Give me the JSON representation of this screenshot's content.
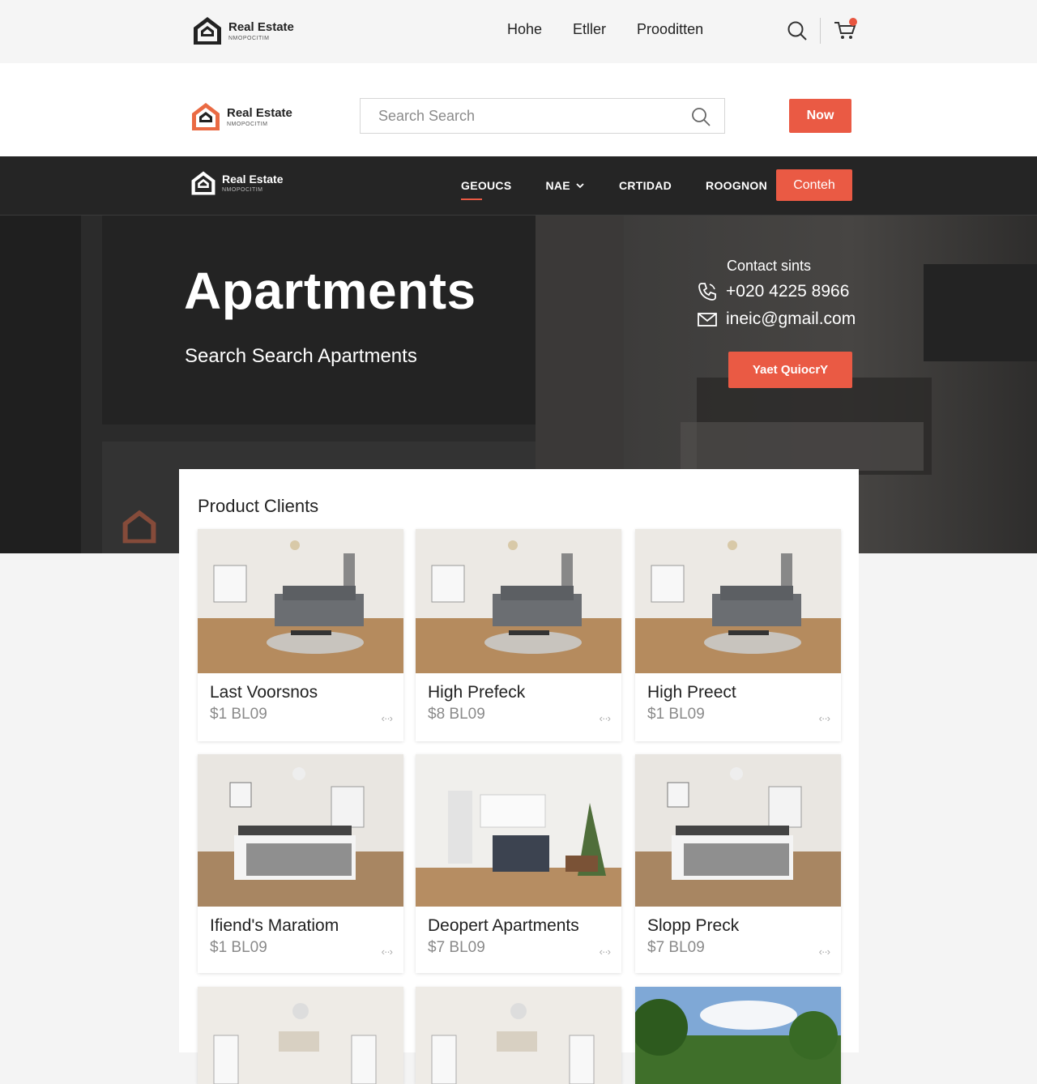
{
  "brand": {
    "name": "Real Estate",
    "tagline": "NMOPOCITIM"
  },
  "top_nav": {
    "items": [
      "Hohe",
      "Etller",
      "Prooditten"
    ]
  },
  "search": {
    "placeholder": "Search Search"
  },
  "cta_now": "Now",
  "main_nav": {
    "items": [
      "GEOUCS",
      "NAE",
      "CRTIDAD",
      "ROOGNON"
    ],
    "cta": "Conteh"
  },
  "hero": {
    "title": "Apartments",
    "subtitle": "Search Search Apartments",
    "contact_label": "Contact sints",
    "phone": "+020 4225 8966",
    "email": "ineic@gmail.com",
    "quote_button": "Yaet QuiocrY"
  },
  "listing": {
    "title": "Product Clients",
    "cards": [
      {
        "title": "Last Voorsnos",
        "price": "$1 BL09",
        "scene": "living"
      },
      {
        "title": "High Prefeck",
        "price": "$8 BL09",
        "scene": "living"
      },
      {
        "title": "High Preect",
        "price": "$1 BL09",
        "scene": "living"
      },
      {
        "title": "Ifiend's Maratiom",
        "price": "$1 BL09",
        "scene": "bedroom"
      },
      {
        "title": "Deopert Apartments",
        "price": "$7 BL09",
        "scene": "kitchen"
      },
      {
        "title": "Slopp Preck",
        "price": "$7 BL09",
        "scene": "bedroom"
      },
      {
        "title": "",
        "price": "",
        "scene": "ceiling"
      },
      {
        "title": "",
        "price": "",
        "scene": "ceiling"
      },
      {
        "title": "",
        "price": "",
        "scene": "outdoor"
      }
    ]
  },
  "colors": {
    "accent": "#ea5a44",
    "dark_nav": "#252525",
    "hero_dark": "#2b2b2b"
  }
}
